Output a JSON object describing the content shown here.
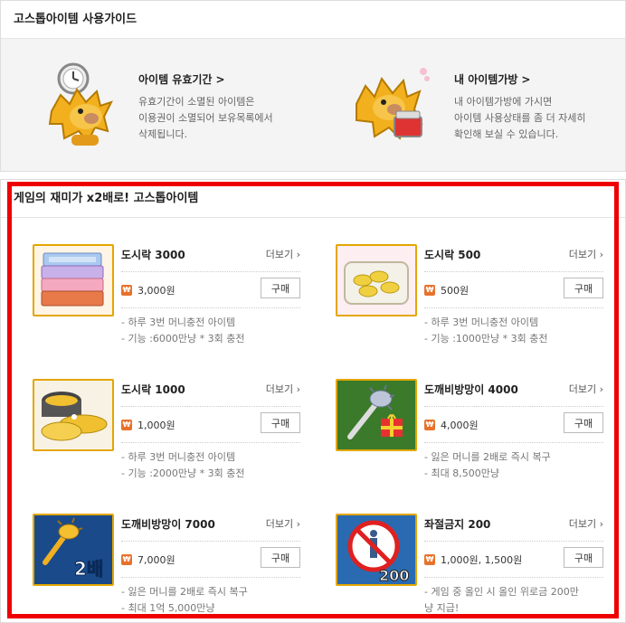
{
  "guide": {
    "title": "고스톱아이템 사용가이드",
    "items": [
      {
        "title": "아이템 유효기간",
        "lines": [
          "유효기간이 소멸된 아이템은",
          "이용권이 소멸되어 보유목록에서",
          "삭제됩니다."
        ]
      },
      {
        "title": "내 아이템가방",
        "lines": [
          "내 아이템가방에 가시면",
          "아이템 사용상태를 좀 더 자세히",
          "확인해 보실 수 있습니다."
        ]
      }
    ]
  },
  "shop": {
    "title": "게임의 재미가 x2배로! 고스톱아이템",
    "more_label": "더보기",
    "buy_label": "구매",
    "currency_icon": "₩",
    "items": [
      {
        "name": "도시락 3000",
        "price": "3,000원",
        "desc": [
          "- 하루 3번 머니충전 아이템",
          "- 기능 :6000만냥 * 3회 충전"
        ],
        "icon": "lunchbox-stack-icon"
      },
      {
        "name": "도시락 500",
        "price": "500원",
        "desc": [
          "- 하루 3번 머니충전 아이템",
          "- 기능 :1000만냥 * 3회 충전"
        ],
        "icon": "lunchbox-gold-icon"
      },
      {
        "name": "도시락 1000",
        "price": "1,000원",
        "desc": [
          "- 하루 3번 머니충전 아이템",
          "- 기능 :2000만냥 * 3회 충전"
        ],
        "icon": "gold-pots-icon"
      },
      {
        "name": "도깨비방망이 4000",
        "price": "4,000원",
        "desc": [
          "- 잃은 머니를 2배로 즉시 복구",
          "- 최대 8,500만냥"
        ],
        "icon": "goblin-club-gift-icon"
      },
      {
        "name": "도깨비방망이 7000",
        "price": "7,000원",
        "desc": [
          "- 잃은 머니를 2배로 즉시 복구",
          "- 최대 1억 5,000만냥"
        ],
        "icon": "goblin-club-2x-icon",
        "badge": "2배"
      },
      {
        "name": "좌절금지 200",
        "price": "1,000원, 1,500원",
        "desc": [
          "- 게임 중 올인 시 올인 위로금 200만",
          "냥 지급!"
        ],
        "icon": "no-despair-icon",
        "badge": "200"
      }
    ]
  },
  "colors": {
    "highlight": "#ee0000",
    "thumb_border": "#e3a600",
    "won_badge": "#e8722c"
  }
}
